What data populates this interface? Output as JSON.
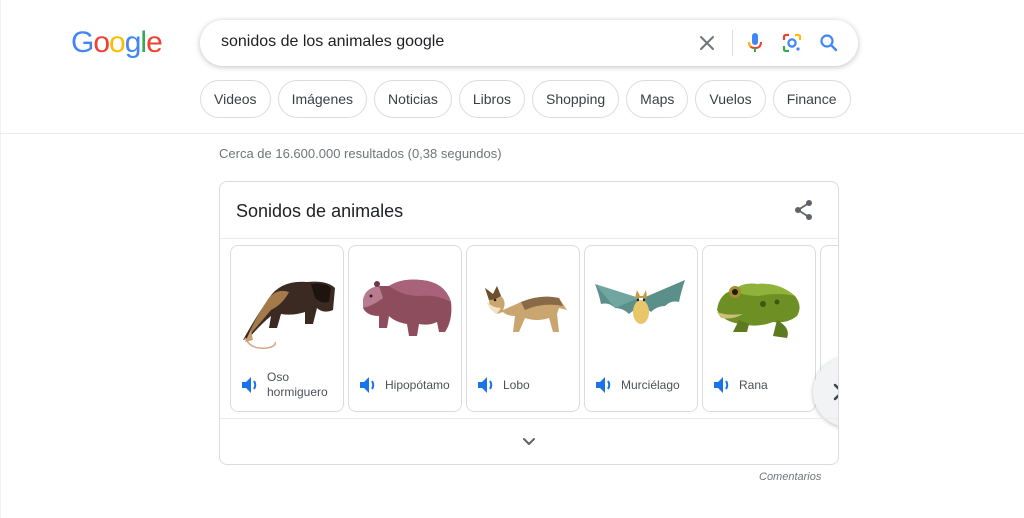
{
  "logo": {
    "letters": [
      "G",
      "o",
      "o",
      "g",
      "l",
      "e"
    ],
    "colors": [
      "#4285F4",
      "#EA4335",
      "#FBBC05",
      "#4285F4",
      "#34A853",
      "#EA4335"
    ]
  },
  "search": {
    "query": "sonidos de los animales google",
    "icons": [
      "close-icon",
      "microphone-icon",
      "lens-icon",
      "search-icon"
    ]
  },
  "filters": [
    "Videos",
    "Imágenes",
    "Noticias",
    "Libros",
    "Shopping",
    "Maps",
    "Vuelos",
    "Finance"
  ],
  "stats": "Cerca de 16.600.000 resultados (0,38 segundos)",
  "panel": {
    "title": "Sonidos de animales",
    "share_icon": "share-icon",
    "animals": [
      {
        "name": "Oso hormiguero",
        "icon": "anteater-image"
      },
      {
        "name": "Hipopótamo",
        "icon": "hippo-image"
      },
      {
        "name": "Lobo",
        "icon": "wolf-image"
      },
      {
        "name": "Murciélago",
        "icon": "bat-image"
      },
      {
        "name": "Rana",
        "icon": "frog-image"
      }
    ],
    "speaker_icon": "speaker-icon",
    "expand_icon": "chevron-down-icon",
    "next_icon": "chevron-right-icon"
  },
  "feedback": "Comentarios",
  "accent": "#1a73e8"
}
